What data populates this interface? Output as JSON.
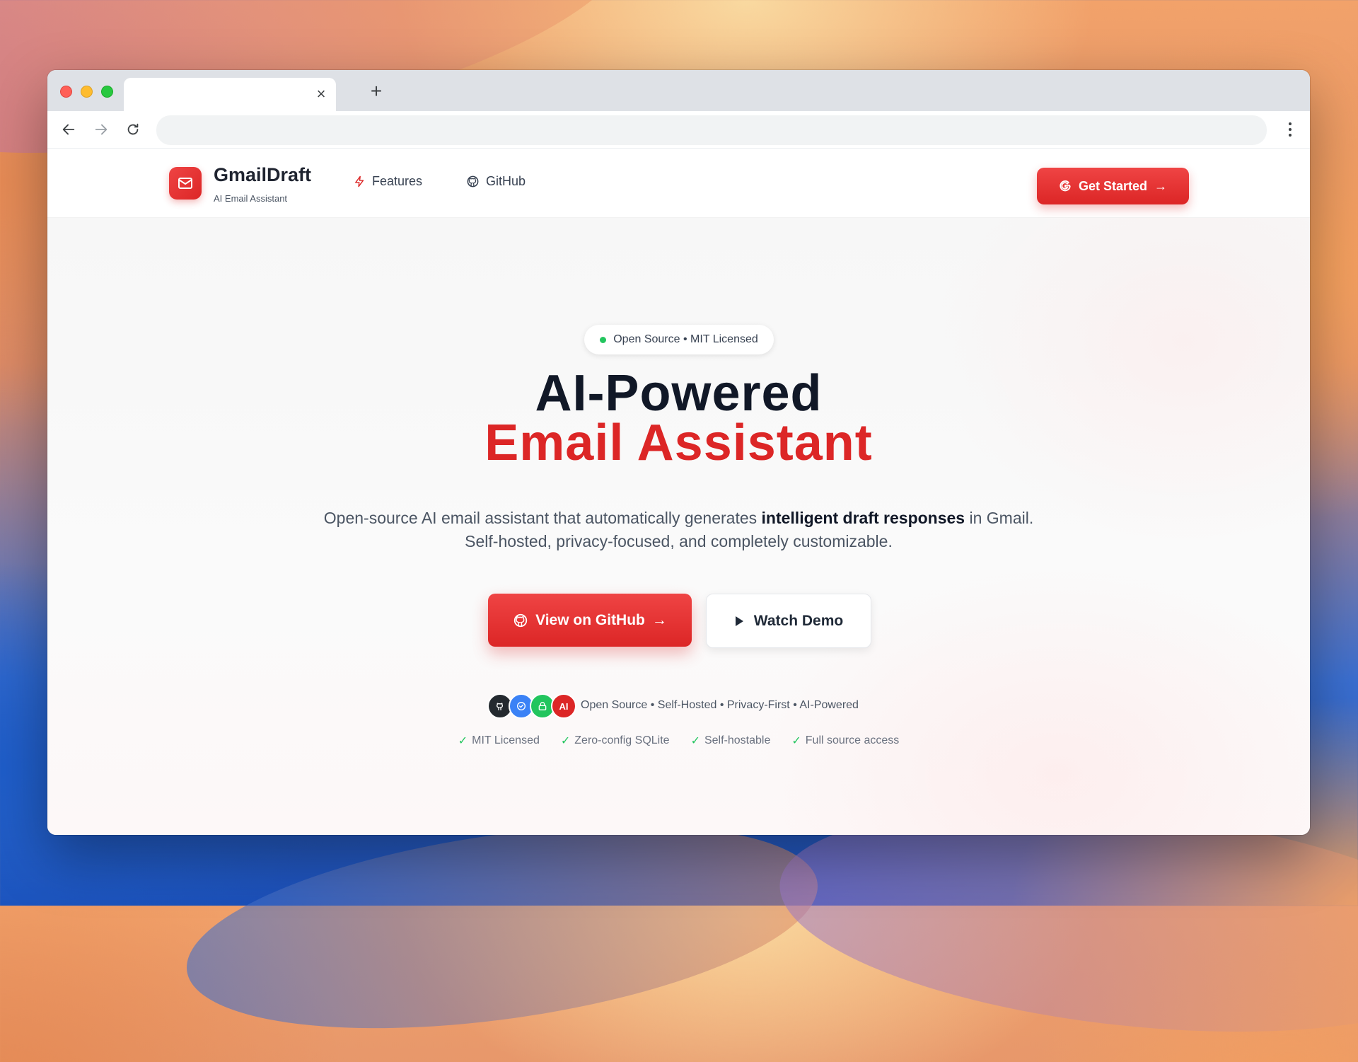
{
  "browser": {
    "tab_close_icon": "close-icon",
    "new_tab_icon": "plus-icon",
    "address_value": ""
  },
  "site": {
    "brand_name": "GmailDraft",
    "brand_tagline": "AI Email Assistant",
    "nav": [
      {
        "label": "Features",
        "icon": "bolt-icon"
      },
      {
        "label": "GitHub",
        "icon": "github-icon"
      }
    ],
    "cta_label": "Get Started",
    "cta_arrow": "→"
  },
  "hero": {
    "pill_text": "Open Source • MIT Licensed",
    "title_line1": "AI-Powered",
    "title_line2": "Email Assistant",
    "subtitle_pre": "Open-source AI email assistant that automatically generates ",
    "subtitle_bold": "intelligent draft responses",
    "subtitle_post": " in Gmail.",
    "subtitle_line2": "Self-hosted, privacy-focused, and completely customizable.",
    "primary_button": "View on GitHub",
    "primary_arrow": "→",
    "secondary_button": "Watch Demo",
    "badge_ai_label": "AI",
    "trust_text": "Open Source • Self-Hosted • Privacy-First • AI-Powered",
    "checks": [
      "MIT Licensed",
      "Zero-config SQLite",
      "Self-hostable",
      "Full source access"
    ],
    "check_glyph": "✓"
  },
  "colors": {
    "accent": "#dc2626",
    "success": "#22c55e"
  }
}
